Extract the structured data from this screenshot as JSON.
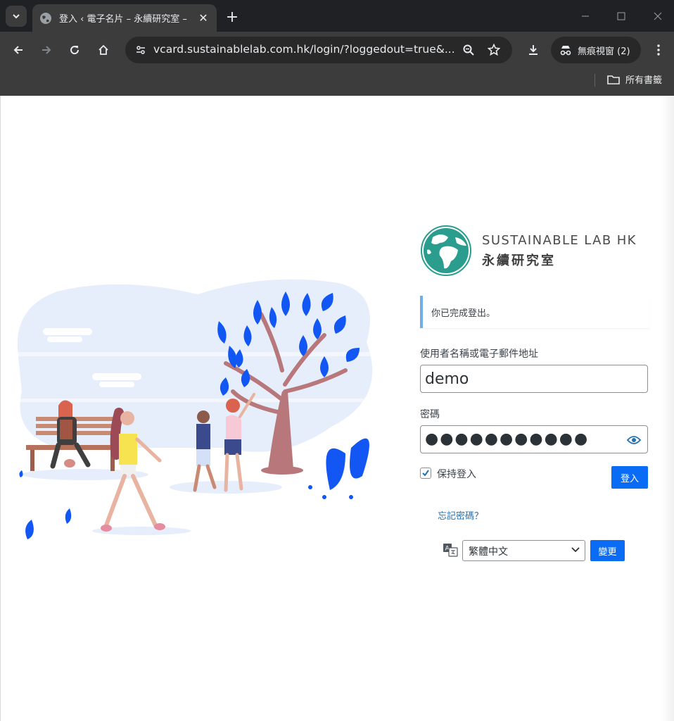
{
  "browser": {
    "tab_title": "登入 ‹ 電子名片 – 永續研究室 –",
    "url": "vcard.sustainablelab.com.hk/login/?loggedout=true&...",
    "incognito_label": "無痕視窗 (2)",
    "bookmarks_label": "所有書籤"
  },
  "logo": {
    "name_en": "SUSTAINABLE LAB HK",
    "name_zh": "永續研究室"
  },
  "notice": "你已完成登出。",
  "form": {
    "username_label": "使用者名稱或電子郵件地址",
    "username_value": "demo",
    "password_label": "密碼",
    "password_masked": "●●●●●●●●●●●",
    "remember_label": "保持登入",
    "remember_checked": true,
    "submit_label": "登入",
    "forgot_label": "忘記密碼？"
  },
  "language": {
    "selected": "繁體中文",
    "change_label": "變更"
  },
  "colors": {
    "accent": "#0a6cf5",
    "link": "#2271b1",
    "notice_bar": "#72aee6",
    "globe_ocean": "#2a9d8f"
  }
}
